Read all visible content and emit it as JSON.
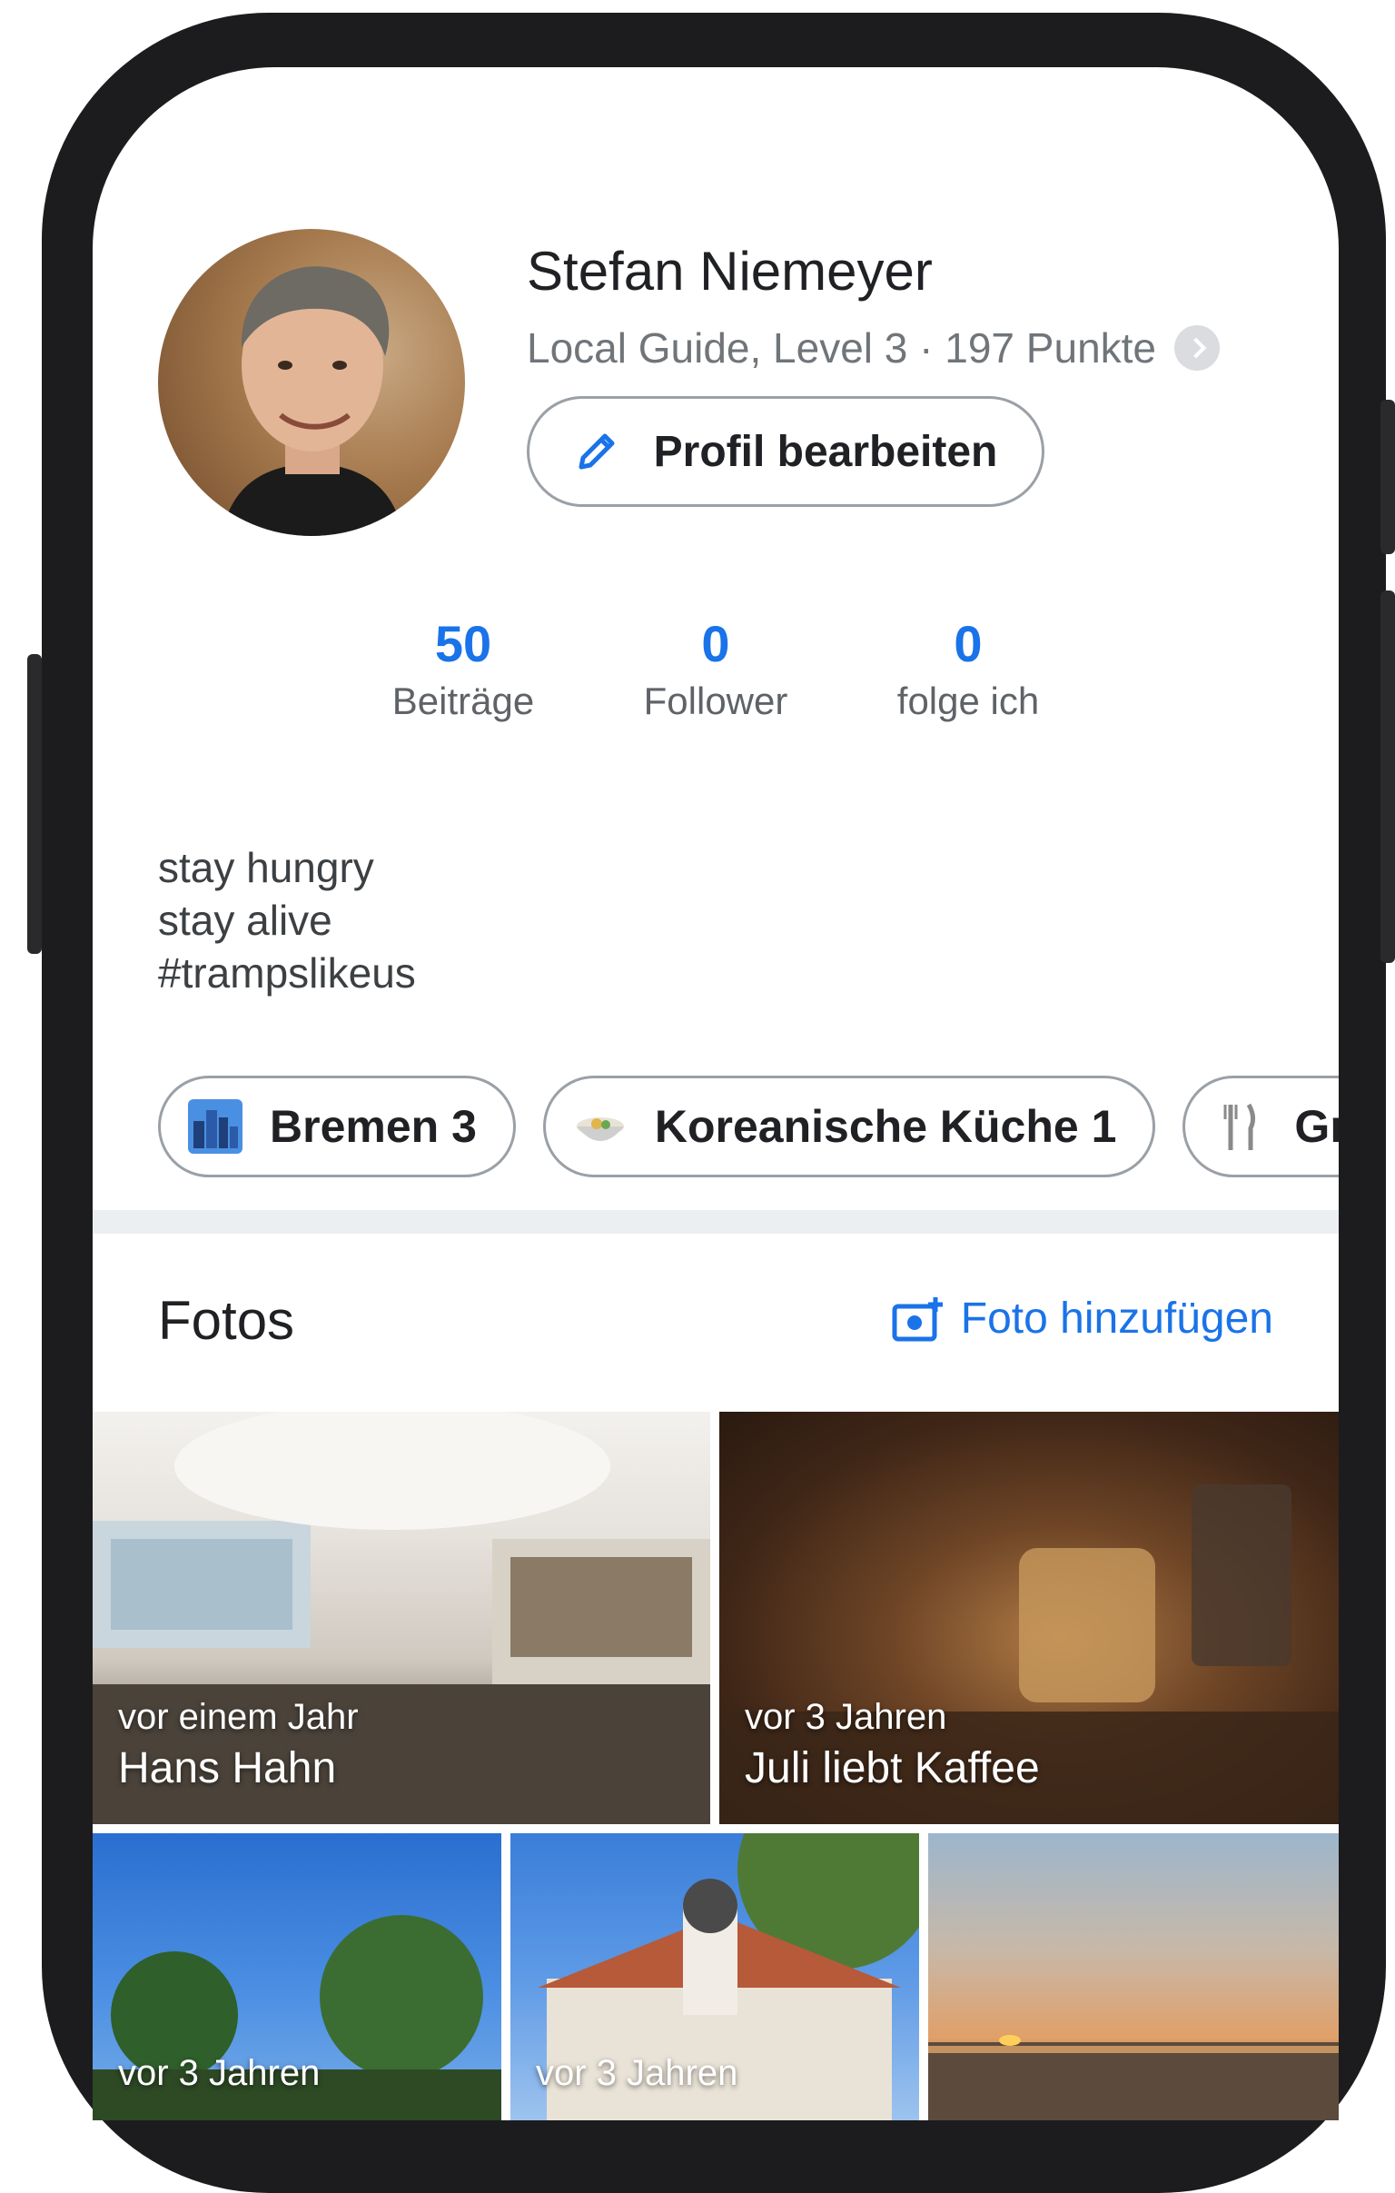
{
  "profile": {
    "name": "Stefan Niemeyer",
    "level": "Local Guide, Level 3 · 197 Punkte",
    "edit_label": "Profil bearbeiten"
  },
  "stats": [
    {
      "value": "50",
      "label": "Beiträge"
    },
    {
      "value": "0",
      "label": "Follower"
    },
    {
      "value": "0",
      "label": "folge ich"
    }
  ],
  "bio": [
    "stay hungry",
    "stay alive",
    "#trampslikeus"
  ],
  "chips": [
    {
      "label": "Bremen 3",
      "icon": "city-icon"
    },
    {
      "label": "Koreanische Küche 1",
      "icon": "bowl-icon"
    },
    {
      "label": "Griec",
      "icon": "fork-knife-icon"
    }
  ],
  "fotos": {
    "title": "Fotos",
    "add_label": "Foto hinzufügen",
    "items": [
      {
        "ago": "vor einem Jahr",
        "title": "Hans Hahn"
      },
      {
        "ago": "vor 3 Jahren",
        "title": "Juli liebt Kaffee"
      },
      {
        "ago": "vor 3 Jahren",
        "title": ""
      },
      {
        "ago": "vor 3 Jahren",
        "title": ""
      },
      {
        "ago": "",
        "title": ""
      }
    ]
  },
  "colors": {
    "accent": "#1a73e8",
    "text": "#202124",
    "muted": "#70757a"
  }
}
